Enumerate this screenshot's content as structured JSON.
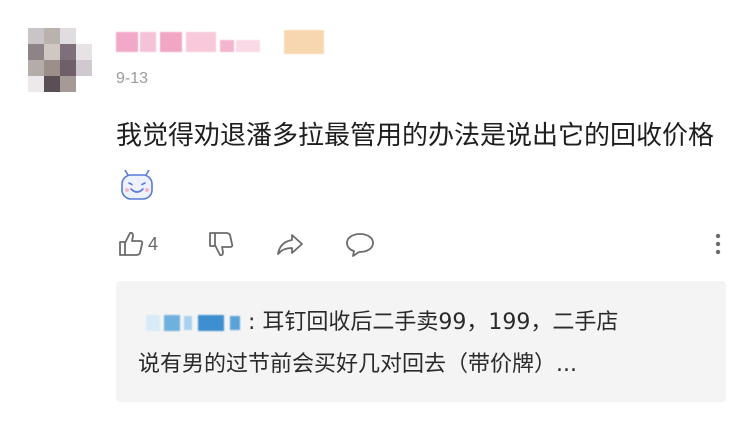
{
  "comment": {
    "date": "9-13",
    "text": "我觉得劝退潘多拉最管用的办法是说出它的回收价格",
    "emoji": "grinning-face-emoji"
  },
  "actions": {
    "like_count": "4",
    "like_icon": "thumbs-up-icon",
    "dislike_icon": "thumbs-down-icon",
    "share_icon": "share-arrow-icon",
    "reply_icon": "speech-bubble-icon",
    "more_icon": "vertical-dots-icon"
  },
  "reply": {
    "text_line1": ": 耳钉回收后二手卖99，199，二手店",
    "text_line2": "说有男的过节前会买好几对回去（带价牌）..."
  },
  "colors": {
    "icon": "#6b6b6b",
    "date": "#9a9a9a",
    "reply_bg": "#f4f4f4",
    "emoji_outline": "#5a7bd6"
  }
}
